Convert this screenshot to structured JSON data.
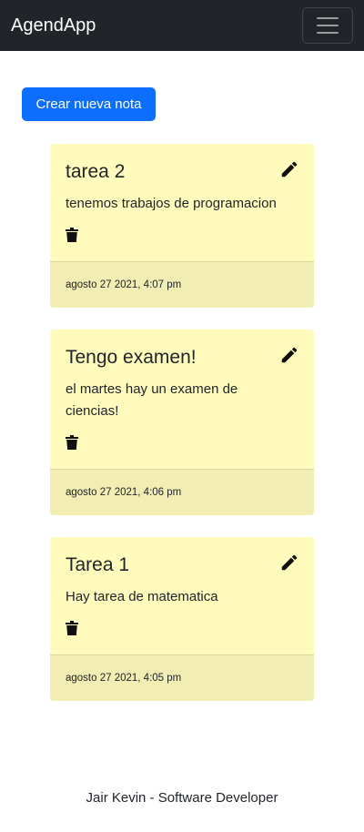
{
  "navbar": {
    "brand": "AgendApp",
    "toggler_icon": "hamburger-menu-icon"
  },
  "actions": {
    "new_note_label": "Crear nueva nota",
    "accent_color": "#0d6efd"
  },
  "notes": [
    {
      "title": "tarea 2",
      "text": "tenemos trabajos de programacion",
      "date": "agosto 27 2021, 4:07 pm"
    },
    {
      "title": "Tengo examen!",
      "text": "el martes hay un examen de ciencias!",
      "date": "agosto 27 2021, 4:06 pm"
    },
    {
      "title": "Tarea 1",
      "text": "Hay tarea de matematica",
      "date": "agosto 27 2021, 4:05 pm"
    }
  ],
  "note_icons": {
    "edit": "pencil-icon",
    "delete": "trash-icon"
  },
  "note_colors": {
    "card_background": "#fffbbd",
    "footer_background": "#f1edb3"
  },
  "footer": {
    "text": "Jair Kevin - Software Developer"
  }
}
